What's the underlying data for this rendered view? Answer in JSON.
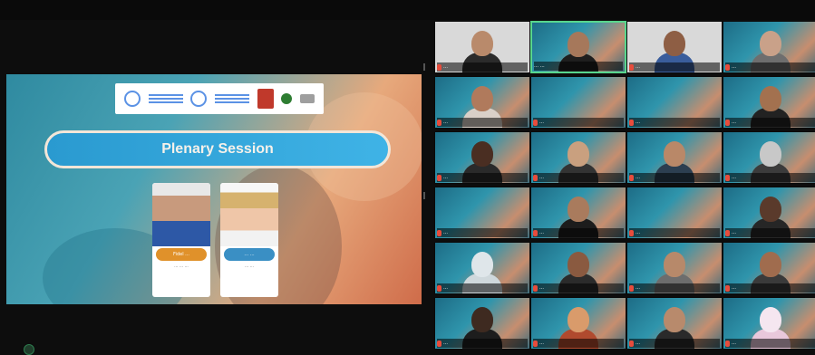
{
  "slide": {
    "title": "Plenary Session",
    "speakers": [
      {
        "name": "Fidel ...",
        "role": "... ... ..."
      },
      {
        "name": "... ...",
        "role": "... ..."
      }
    ]
  },
  "participants": [
    {
      "name": "...",
      "skin": "#b98a6b",
      "shirt": "#2b2b2b",
      "bg": "plain",
      "muted": true,
      "active": false
    },
    {
      "name": "... ...",
      "skin": "#a6785b",
      "shirt": "#1e1e1e",
      "bg": "vbg",
      "muted": false,
      "active": true
    },
    {
      "name": "...",
      "skin": "#8e5e44",
      "shirt": "#3a5d9c",
      "bg": "plain",
      "muted": true,
      "active": false
    },
    {
      "name": "...",
      "skin": "#c9a189",
      "shirt": "#6e6e6e",
      "bg": "vbg",
      "muted": true,
      "active": false
    },
    {
      "name": "...",
      "skin": "#b07a5c",
      "shirt": "#d9d0c8",
      "bg": "vbg",
      "muted": true,
      "active": false
    },
    {
      "name": "...",
      "skin": "",
      "shirt": "",
      "bg": "vbg",
      "muted": true,
      "active": false
    },
    {
      "name": "...",
      "skin": "",
      "shirt": "",
      "bg": "vbg",
      "muted": true,
      "active": false
    },
    {
      "name": "...",
      "skin": "#a3714f",
      "shirt": "#222222",
      "bg": "vbg",
      "muted": true,
      "active": false
    },
    {
      "name": "...",
      "skin": "#4a2e22",
      "shirt": "#2a2a2a",
      "bg": "vbg",
      "muted": true,
      "active": false
    },
    {
      "name": "...",
      "skin": "#c9a07f",
      "shirt": "#333333",
      "bg": "vbg",
      "muted": true,
      "active": false
    },
    {
      "name": "...",
      "skin": "#b98868",
      "shirt": "#2c3e50",
      "bg": "vbg",
      "muted": true,
      "active": false
    },
    {
      "name": "...",
      "skin": "#c8c8c8",
      "shirt": "#3b3b3b",
      "bg": "vbg",
      "muted": true,
      "active": false
    },
    {
      "name": "...",
      "skin": "",
      "shirt": "",
      "bg": "vbg",
      "muted": true,
      "active": false
    },
    {
      "name": "...",
      "skin": "#a97b5d",
      "shirt": "#1c1c1c",
      "bg": "vbg",
      "muted": true,
      "active": false
    },
    {
      "name": "...",
      "skin": "",
      "shirt": "",
      "bg": "vbg",
      "muted": true,
      "active": false
    },
    {
      "name": "...",
      "skin": "#5a3a2b",
      "shirt": "#262626",
      "bg": "vbg",
      "muted": true,
      "active": false
    },
    {
      "name": "...",
      "skin": "#dfe6ea",
      "shirt": "#cfd8dc",
      "bg": "vbg",
      "muted": true,
      "active": false
    },
    {
      "name": "...",
      "skin": "#8a5a40",
      "shirt": "#2b2b2b",
      "bg": "vbg",
      "muted": true,
      "active": false
    },
    {
      "name": "...",
      "skin": "#b7896a",
      "shirt": "#6d6d6d",
      "bg": "vbg",
      "muted": true,
      "active": false
    },
    {
      "name": "...",
      "skin": "#a06c4e",
      "shirt": "#3a3a3a",
      "bg": "vbg",
      "muted": true,
      "active": false
    },
    {
      "name": "...",
      "skin": "#3e2a20",
      "shirt": "#1d1d1d",
      "bg": "vbg",
      "muted": true,
      "active": false
    },
    {
      "name": "...",
      "skin": "#d99b6b",
      "shirt": "#b04a2e",
      "bg": "vbg",
      "muted": true,
      "active": false
    },
    {
      "name": "...",
      "skin": "#b88a6c",
      "shirt": "#2a2a2a",
      "bg": "vbg",
      "muted": true,
      "active": false
    },
    {
      "name": "...",
      "skin": "#f5e6f0",
      "shirt": "#e9c8db",
      "bg": "vbg",
      "muted": true,
      "active": false
    }
  ]
}
